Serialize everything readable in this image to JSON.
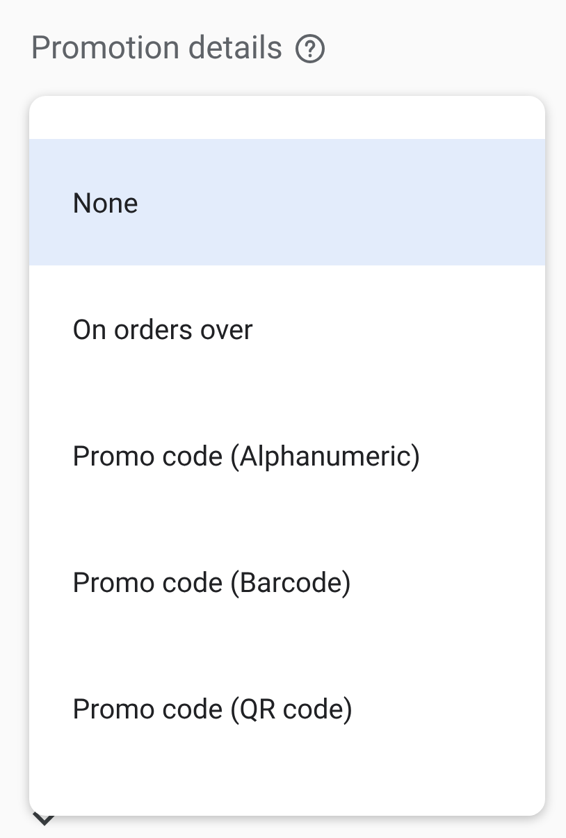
{
  "section": {
    "title": "Promotion details"
  },
  "menu": {
    "items": [
      {
        "label": "None",
        "selected": true
      },
      {
        "label": "On orders over",
        "selected": false
      },
      {
        "label": "Promo code (Alphanumeric)",
        "selected": false
      },
      {
        "label": "Promo code (Barcode)",
        "selected": false
      },
      {
        "label": "Promo code (QR code)",
        "selected": false
      }
    ]
  },
  "url_options": {
    "expanded": false
  }
}
